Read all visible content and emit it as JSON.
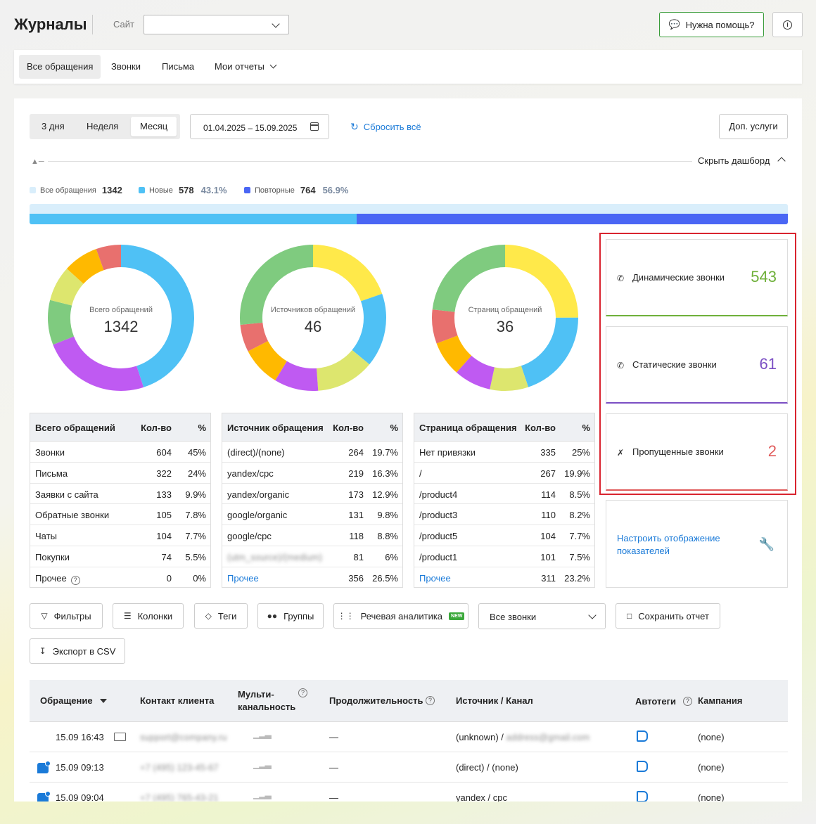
{
  "header": {
    "title": "Журналы",
    "site_label": "Сайт",
    "site_value": "",
    "help_label": "Нужна помощь?"
  },
  "tabs": [
    {
      "label": "Все обращения",
      "active": true
    },
    {
      "label": "Звонки"
    },
    {
      "label": "Письма"
    },
    {
      "label": "Мои отчеты"
    }
  ],
  "filters": {
    "periods": [
      "3 дня",
      "Неделя",
      "Месяц"
    ],
    "active_period": "Месяц",
    "date_range": "01.04.2025 – 15.09.2025",
    "reset_label": "Сбросить всё",
    "extra_label": "Доп. услуги",
    "hide_dashboard_label": "Скрыть дашборд"
  },
  "summary": {
    "all_label": "Все обращения",
    "all_value": "1342",
    "new_label": "Новые",
    "new_value": "578",
    "new_pct": "43.1%",
    "repeat_label": "Повторные",
    "repeat_value": "764",
    "repeat_pct": "56.9%",
    "new_fraction": 0.431,
    "colors": {
      "all": "#d9eefb",
      "new": "#4fc1f5",
      "repeat": "#4a66f4"
    }
  },
  "donuts": [
    {
      "label": "Всего обращений",
      "value": "1342",
      "segments": [
        604,
        322,
        133,
        105,
        104,
        74
      ],
      "colors": [
        "#4fc1f5",
        "#bf5af2",
        "#7fcb7f",
        "#dde66e",
        "#ffb900",
        "#e8706e"
      ]
    },
    {
      "label": "Источников обращений",
      "value": "46",
      "segments": [
        264,
        219,
        173,
        131,
        118,
        81,
        356
      ],
      "colors": [
        "#ffe94a",
        "#4fc1f5",
        "#dde66e",
        "#bf5af2",
        "#ffb900",
        "#e8706e",
        "#7fcb7f"
      ]
    },
    {
      "label": "Страниц обращений",
      "value": "36",
      "segments": [
        335,
        267,
        114,
        110,
        104,
        101,
        311
      ],
      "colors": [
        "#ffe94a",
        "#4fc1f5",
        "#dde66e",
        "#bf5af2",
        "#ffb900",
        "#e8706e",
        "#7fcb7f"
      ]
    }
  ],
  "tables": [
    {
      "headers": [
        "Всего обращений",
        "Кол-во",
        "%"
      ],
      "rows": [
        [
          "Звонки",
          "604",
          "45%"
        ],
        [
          "Письма",
          "322",
          "24%"
        ],
        [
          "Заявки с сайта",
          "133",
          "9.9%"
        ],
        [
          "Обратные звонки",
          "105",
          "7.8%"
        ],
        [
          "Чаты",
          "104",
          "7.7%"
        ],
        [
          "Покупки",
          "74",
          "5.5%"
        ],
        [
          "Прочее",
          "0",
          "0%"
        ]
      ]
    },
    {
      "headers": [
        "Источник обращения",
        "Кол-во",
        "%"
      ],
      "rows": [
        [
          "(direct)/(none)",
          "264",
          "19.7%"
        ],
        [
          "yandex/cpc",
          "219",
          "16.3%"
        ],
        [
          "yandex/organic",
          "173",
          "12.9%"
        ],
        [
          "google/organic",
          "131",
          "9.8%"
        ],
        [
          "google/cpc",
          "118",
          "8.8%"
        ],
        [
          "",
          "81",
          "6%"
        ],
        [
          "Прочее",
          "356",
          "26.5%"
        ]
      ]
    },
    {
      "headers": [
        "Страница обращения",
        "Кол-во",
        "%"
      ],
      "rows": [
        [
          "Нет привязки",
          "335",
          "25%"
        ],
        [
          "/",
          "267",
          "19.9%"
        ],
        [
          "/product4",
          "114",
          "8.5%"
        ],
        [
          "/product3",
          "110",
          "8.2%"
        ],
        [
          "/product5",
          "104",
          "7.7%"
        ],
        [
          "/product1",
          "101",
          "7.5%"
        ],
        [
          "Прочее",
          "311",
          "23.2%"
        ]
      ]
    }
  ],
  "kpis": [
    {
      "label": "Динамические звонки",
      "value": "543",
      "color": "#6fb03a"
    },
    {
      "label": "Статические звонки",
      "value": "61",
      "color": "#7b4fc4"
    },
    {
      "label": "Пропущенные звонки",
      "value": "2",
      "color": "#e05a5a"
    }
  ],
  "configure_label": "Настроить отображение показателей",
  "toolbar": {
    "filters": "Фильтры",
    "columns": "Колонки",
    "tags": "Теги",
    "groups": "Группы",
    "speech": "Речевая аналитика",
    "new_badge": "NEW",
    "calls_select": "Все звонки",
    "save_report": "Сохранить отчет",
    "export_csv": "Экспорт в CSV"
  },
  "grid": {
    "headers": {
      "request": "Обращение",
      "contact": "Контакт клиента",
      "multi_1": "Мульти-",
      "multi_2": "канальность",
      "duration": "Продолжительность",
      "source": "Источник / Канал",
      "autotags": "Автотеги",
      "campaign": "Кампания"
    },
    "rows": [
      {
        "date": "15.09 16:43",
        "kind": "mail",
        "contact": "",
        "duration": "—",
        "source": "(unknown) / ",
        "campaign": "(none)"
      },
      {
        "date": "15.09 09:13",
        "kind": "chat",
        "contact": "",
        "duration": "—",
        "source": "(direct) / (none)",
        "campaign": "(none)"
      },
      {
        "date": "15.09 09:04",
        "kind": "chat",
        "contact": "",
        "duration": "—",
        "source": "yandex / cpc",
        "campaign": "(none)"
      }
    ]
  }
}
